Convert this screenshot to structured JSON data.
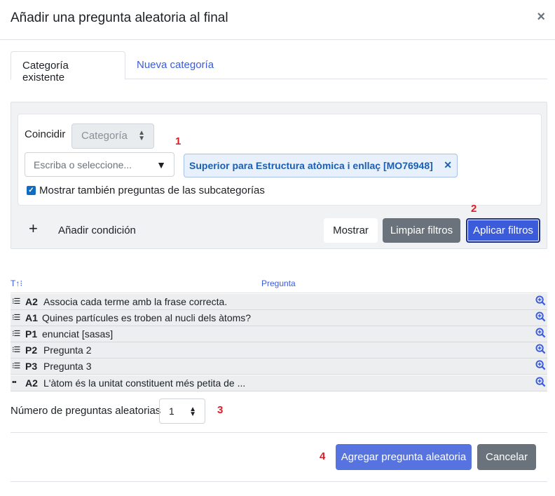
{
  "dialog": {
    "title": "Añadir una pregunta aleatoria al final",
    "close_glyph": "×"
  },
  "tabs": [
    {
      "label": "Categoría existente",
      "active": true
    },
    {
      "label": "Nueva categoría",
      "active": false
    }
  ],
  "filter": {
    "match_label": "Coincidir",
    "match_select_value": "Categoría",
    "search_placeholder": "Escriba o seleccione...",
    "selected_category": "Superior para Estructura atòmica i enllaç [MO76948]",
    "subcategories_checkbox_label": "Mostrar también preguntas de las subcategorías",
    "subcategories_checked": true,
    "add_condition_label": "Añadir condición",
    "show_button": "Mostrar",
    "clear_button": "Limpiar filtros",
    "apply_button": "Aplicar filtros"
  },
  "annotations": {
    "n1": "1",
    "n2": "2",
    "n3": "3",
    "n4": "4"
  },
  "table": {
    "sort_header": "T↑⁝",
    "question_header": "Pregunta",
    "rows": [
      {
        "icon": "matching-icon",
        "name": "A2",
        "text": "Associa cada terme amb la frase correcta."
      },
      {
        "icon": "multichoice-icon",
        "name": "A1",
        "text": "Quines partícules es troben al nucli dels àtoms?"
      },
      {
        "icon": "multichoice-icon",
        "name": "P1",
        "text": "enunciat [sasas]"
      },
      {
        "icon": "multichoice-icon",
        "name": "P2",
        "text": "Pregunta 2"
      },
      {
        "icon": "multichoice-icon",
        "name": "P3",
        "text": "Pregunta 3"
      },
      {
        "icon": "gapselect-icon",
        "name": "A2",
        "text": "L'àtom és la unitat constituent més petita de ..."
      }
    ]
  },
  "random_count": {
    "label": "Número de preguntas aleatorias",
    "value": "1"
  },
  "footer": {
    "add_button": "Agregar pregunta aleatoria",
    "cancel_button": "Cancelar"
  },
  "colors": {
    "accent": "#3b5bdb",
    "annotation_red": "#e01b24",
    "secondary_button": "#6a737b"
  }
}
